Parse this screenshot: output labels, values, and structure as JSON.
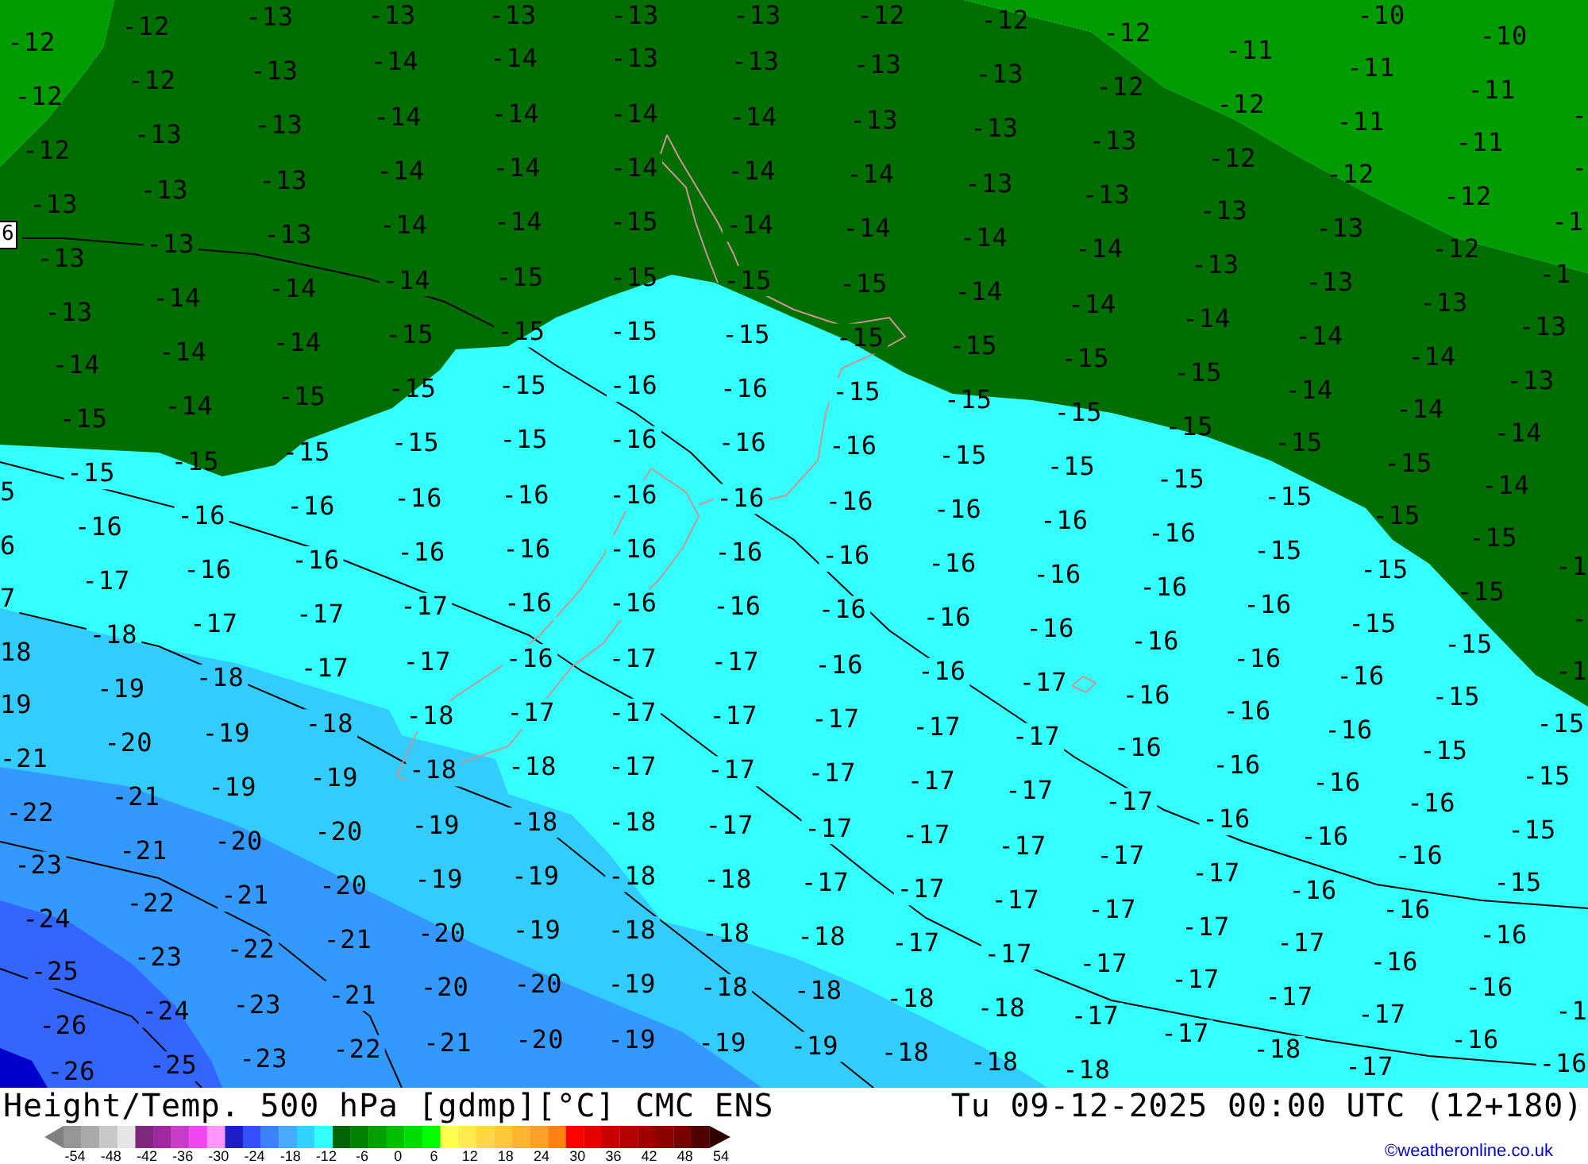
{
  "map": {
    "contour_value": "6",
    "label_columns": [
      [
        "5",
        "6",
        "7",
        "18",
        "19",
        "-21",
        "-22",
        "-23",
        "-24",
        "-25",
        "-26",
        "-26"
      ],
      [
        "-12",
        "-12",
        "-12",
        "-13",
        "-13",
        "-13",
        "-14",
        "-15",
        "-15",
        "-16",
        "-17",
        "-18",
        "-19",
        "-20",
        "-21",
        "-21",
        "-22",
        "-23",
        "-24",
        "-25"
      ],
      [
        "-12",
        "-12",
        "-13",
        "-13",
        "-13",
        "-14",
        "-14",
        "-14",
        "-15",
        "-16",
        "-16",
        "-17",
        "-18",
        "-19",
        "-19",
        "-20",
        "-21",
        "-22",
        "-23",
        "-23"
      ],
      [
        "-13",
        "-13",
        "-13",
        "-13",
        "-13",
        "-14",
        "-14",
        "-15",
        "-15",
        "-16",
        "-16",
        "-17",
        "-17",
        "-18",
        "-19",
        "-20",
        "-20",
        "-21",
        "-21",
        "-22"
      ],
      [
        "-13",
        "-14",
        "-14",
        "-14",
        "-14",
        "-14",
        "-15",
        "-15",
        "-15",
        "-16",
        "-16",
        "-17",
        "-17",
        "-18",
        "-18",
        "-19",
        "-19",
        "-20",
        "-20",
        "-21"
      ],
      [
        "-13",
        "-14",
        "-14",
        "-14",
        "-14",
        "-15",
        "-15",
        "-15",
        "-15",
        "-16",
        "-16",
        "-16",
        "-16",
        "-17",
        "-18",
        "-18",
        "-19",
        "-19",
        "-20",
        "-20"
      ],
      [
        "-13",
        "-13",
        "-14",
        "-14",
        "-15",
        "-15",
        "-15",
        "-16",
        "-16",
        "-16",
        "-16",
        "-16",
        "-17",
        "-17",
        "-17",
        "-18",
        "-18",
        "-18",
        "-19",
        "-19"
      ],
      [
        "-13",
        "-13",
        "-14",
        "-14",
        "-14",
        "-15",
        "-15",
        "-16",
        "-16",
        "-16",
        "-16",
        "-16",
        "-17",
        "-17",
        "-17",
        "-17",
        "-18",
        "-18",
        "-18",
        "-19"
      ],
      [
        "-12",
        "-13",
        "-13",
        "-14",
        "-14",
        "-15",
        "-15",
        "-15",
        "-16",
        "-16",
        "-16",
        "-16",
        "-16",
        "-17",
        "-17",
        "-17",
        "-17",
        "-18",
        "-18",
        "-19"
      ],
      [
        "-12",
        "-13",
        "-13",
        "-13",
        "-14",
        "-14",
        "-15",
        "-15",
        "-15",
        "-16",
        "-16",
        "-16",
        "-16",
        "-17",
        "-17",
        "-17",
        "-17",
        "-17",
        "-18",
        "-18"
      ],
      [
        "-12",
        "-12",
        "-13",
        "-13",
        "-14",
        "-14",
        "-15",
        "-15",
        "-15",
        "-16",
        "-16",
        "-16",
        "-17",
        "-17",
        "-17",
        "-17",
        "-17",
        "-17",
        "-18",
        "-18"
      ],
      [
        "-11",
        "-12",
        "-12",
        "-13",
        "-13",
        "-14",
        "-15",
        "-15",
        "-15",
        "-16",
        "-16",
        "-16",
        "-16",
        "-16",
        "-17",
        "-17",
        "-17",
        "-17",
        "-17",
        "-18"
      ],
      [
        "-10",
        "-11",
        "-11",
        "-12",
        "-13",
        "-13",
        "-14",
        "-14",
        "-15",
        "-15",
        "-15",
        "-16",
        "-16",
        "-16",
        "-16",
        "-16",
        "-17",
        "-17",
        "-17",
        "-17"
      ],
      [
        "-10",
        "-11",
        "-11",
        "-12",
        "-12",
        "-13",
        "-14",
        "-14",
        "-15",
        "-15",
        "-15",
        "-15",
        "-16",
        "-16",
        "-16",
        "-16",
        "-16",
        "-17",
        "-17",
        "-18"
      ],
      [
        "-",
        "-",
        "-1",
        "-1",
        "-13",
        "-13",
        "-14",
        "-14",
        "-15",
        "-15",
        "-15",
        "-15",
        "-15",
        "-16",
        "-16",
        "-16",
        "-16",
        "-17",
        "-17"
      ],
      [
        "-1",
        "-",
        "-1",
        "-15",
        "-15",
        "-15",
        "-15",
        "-16",
        "-16",
        "-16"
      ],
      [
        "-1",
        "-16"
      ]
    ]
  },
  "footer": {
    "title": "Height/Temp. 500 hPa [gdmp][°C] CMC ENS",
    "valid_time": "Tu 09-12-2025 00:00 UTC (12+180)",
    "scale_labels": [
      "-54",
      "-48",
      "-42",
      "-36",
      "-30",
      "-24",
      "-18",
      "-12",
      "-6",
      "0",
      "6",
      "12",
      "18",
      "24",
      "30",
      "36",
      "42",
      "48",
      "54"
    ],
    "credit": "©weatheronline.co.uk"
  }
}
